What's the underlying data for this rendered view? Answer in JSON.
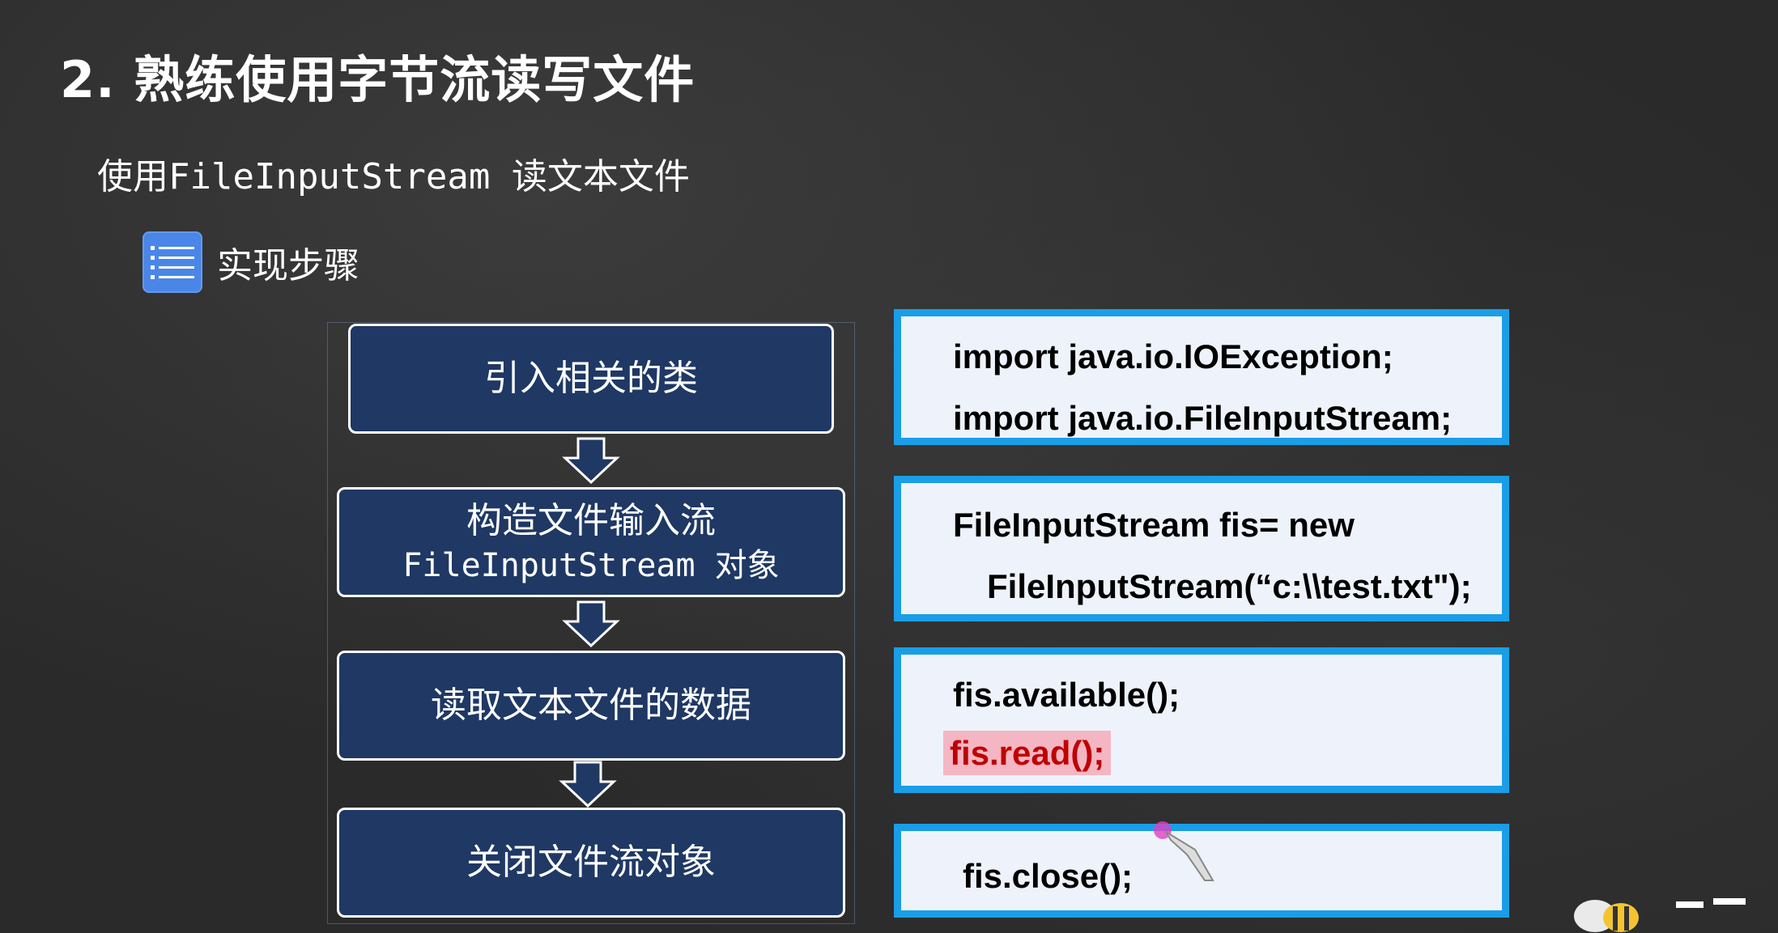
{
  "title": "2. 熟练使用字节流读写文件",
  "subtitle": "使用FileInputStream 读文本文件",
  "steps_header": {
    "icon": "list-icon",
    "label": "实现步骤"
  },
  "flow_steps": [
    {
      "line1": "引入相关的类",
      "line2": ""
    },
    {
      "line1": "构造文件输入流",
      "line2": "FileInputStream 对象"
    },
    {
      "line1": "读取文本文件的数据",
      "line2": ""
    },
    {
      "line1": "关闭文件流对象",
      "line2": ""
    }
  ],
  "code_blocks": [
    {
      "lines": [
        "import java.io.IOException;",
        "import java.io.FileInputStream;"
      ]
    },
    {
      "lines": [
        "FileInputStream fis= new",
        "FileInputStream(“c:\\\\test.txt\");"
      ]
    },
    {
      "lines": [
        "fis.available();",
        "fis.read();"
      ],
      "highlighted_line": 1
    },
    {
      "lines": [
        "fis.close();"
      ]
    }
  ],
  "colors": {
    "flow_box_fill": "#1f3864",
    "code_border": "#1a9ee8",
    "code_fill": "#eef3fb",
    "highlight_bg": "#f4b6c2",
    "highlight_text": "#c00000"
  }
}
